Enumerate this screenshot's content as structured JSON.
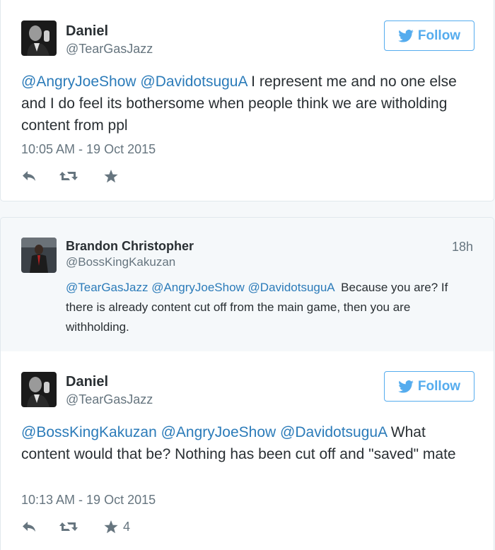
{
  "tweets": [
    {
      "name": "Daniel",
      "handle": "@TearGasJazz",
      "follow_label": "Follow",
      "mentions": [
        "@AngryJoeShow",
        "@DavidotsuguA"
      ],
      "text": " I represent me and no one else and I do feel its bothersome when people think we are witholding content from ppl",
      "timestamp": "10:05 AM - 19 Oct 2015",
      "like_count": ""
    },
    {
      "name": "Daniel",
      "handle": "@TearGasJazz",
      "follow_label": "Follow",
      "mentions": [
        "@BossKingKakuzan",
        "@AngryJoeShow",
        "@DavidotsuguA"
      ],
      "text": " What content would that be? Nothing has been cut off and \"saved\" mate",
      "timestamp": "10:13 AM - 19 Oct 2015",
      "like_count": "4"
    }
  ],
  "reply": {
    "name": "Brandon Christopher",
    "handle": "@BossKingKakuzan",
    "age": "18h",
    "mentions": [
      "@TearGasJazz",
      "@AngryJoeShow",
      "@DavidotsuguA"
    ],
    "text": "  Because you are? If there is already content cut off from the main game, then you are withholding."
  },
  "icons": {
    "reply": "reply-icon",
    "retweet": "retweet-icon",
    "like": "star-icon",
    "follow": "twitter-bird-icon"
  },
  "colors": {
    "link": "#2b7bb9",
    "follow": "#55acee",
    "muted": "#66757f",
    "text": "#292f33"
  }
}
